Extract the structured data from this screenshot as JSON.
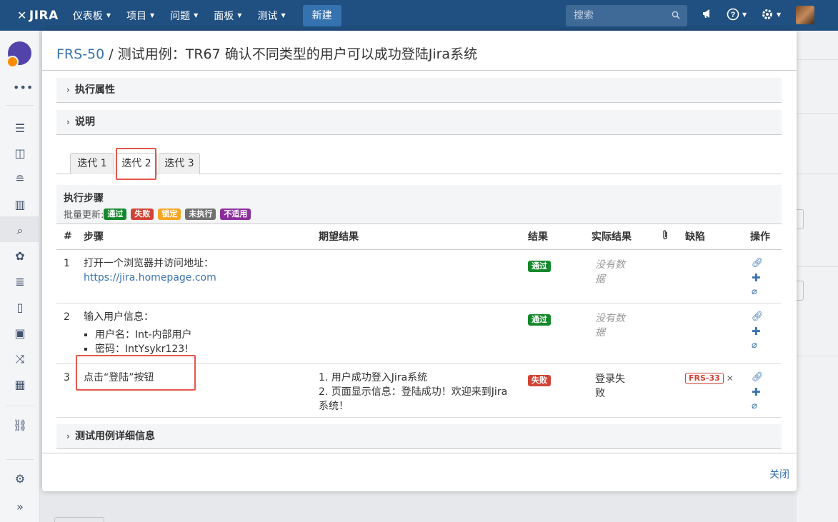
{
  "topnav": {
    "logo": "JIRA",
    "menu": [
      {
        "label": "仪表板"
      },
      {
        "label": "项目"
      },
      {
        "label": "问题"
      },
      {
        "label": "面板"
      },
      {
        "label": "测试"
      }
    ],
    "create_label": "新建",
    "search_placeholder": "搜索"
  },
  "modal": {
    "issue_key": "FRS-50",
    "title_rest": " / 测试用例：TR67 确认不同类型的用户可以成功登陆Jira系统",
    "sections": {
      "exec_props": "执行属性",
      "description": "说明",
      "details": "测试用例详细信息"
    },
    "tabs": [
      {
        "label": "迭代 1"
      },
      {
        "label": "迭代 2"
      },
      {
        "label": "迭代 3"
      }
    ],
    "steps_title": "执行步骤",
    "bulk_label": "批量更新:",
    "bulk_statuses": [
      {
        "label": "通过",
        "color": "#14892c"
      },
      {
        "label": "失败",
        "color": "#d04437"
      },
      {
        "label": "锁定",
        "color": "#f6a623"
      },
      {
        "label": "未执行",
        "color": "#707070"
      },
      {
        "label": "不适用",
        "color": "#8b2f9c"
      }
    ],
    "columns": {
      "num": "#",
      "step": "步骤",
      "expected": "期望结果",
      "result": "结果",
      "actual": "实际结果",
      "defects": "缺陷",
      "actions": "操作"
    },
    "rows": [
      {
        "num": "1",
        "step_text": "打开一个浏览器并访问地址：",
        "step_link": "https://jira.homepage.com",
        "result": "通过",
        "actual_l1": "没有数",
        "actual_l2": "据"
      },
      {
        "num": "2",
        "step_text": "输入用户信息：",
        "bullets": [
          "用户名：Int-内部用户",
          "密码：IntYsykr123!"
        ],
        "result": "通过",
        "actual_l1": "没有数",
        "actual_l2": "据"
      },
      {
        "num": "3",
        "step_text": "点击“登陆”按钮",
        "expected_l1": "1. 用户成功登入Jira系统",
        "expected_l2": "2. 页面显示信息：登陆成功！欢迎来到Jira",
        "expected_l3": "系统！",
        "result": "失败",
        "actual_l1": "登录失",
        "actual_l2": "败",
        "defect": "FRS-33"
      }
    ],
    "close_label": "关闭"
  }
}
